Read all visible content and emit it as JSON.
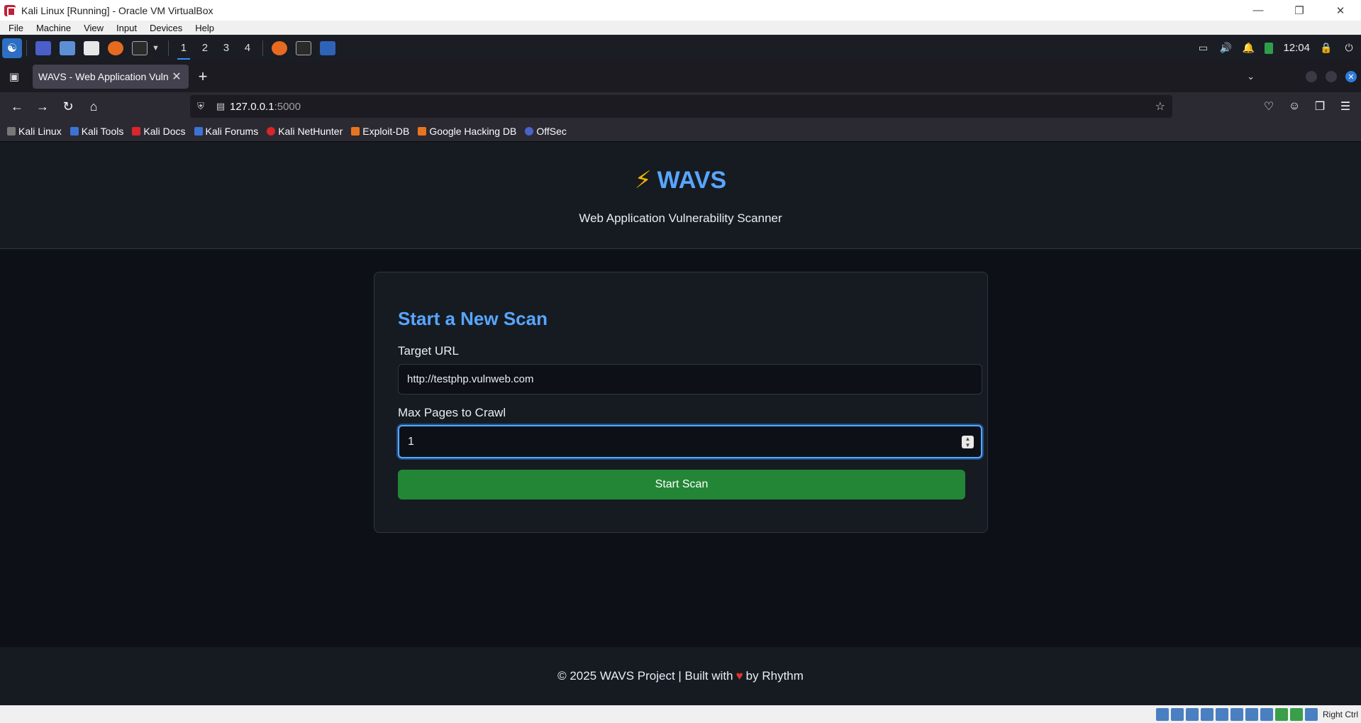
{
  "vbox": {
    "title": "Kali Linux [Running] - Oracle VM VirtualBox",
    "menu": [
      "File",
      "Machine",
      "View",
      "Input",
      "Devices",
      "Help"
    ],
    "host_key": "Right Ctrl"
  },
  "panel": {
    "workspaces": [
      "1",
      "2",
      "3",
      "4"
    ],
    "clock": "12:04"
  },
  "browser": {
    "tab_title": "WAVS - Web Application Vuln",
    "url_host": "127.0.0.1",
    "url_port": ":5000",
    "bookmarks": [
      "Kali Linux",
      "Kali Tools",
      "Kali Docs",
      "Kali Forums",
      "Kali NetHunter",
      "Exploit-DB",
      "Google Hacking DB",
      "OffSec"
    ]
  },
  "site": {
    "brand_icon": "⚡",
    "brand": "WAVS",
    "tagline": "Web Application Vulnerability Scanner",
    "form": {
      "heading": "Start a New Scan",
      "url_label": "Target URL",
      "url_value": "http://testphp.vulnweb.com",
      "pages_label": "Max Pages to Crawl",
      "pages_value": "1",
      "submit": "Start Scan"
    },
    "footer": {
      "before_heart": "© 2025 WAVS Project | Built with",
      "heart": "♥",
      "after_heart": "by Rhythm"
    }
  },
  "colors": {
    "accent": "#58a6ff",
    "button": "#238636",
    "background": "#0d1117",
    "surface": "#161b22"
  }
}
